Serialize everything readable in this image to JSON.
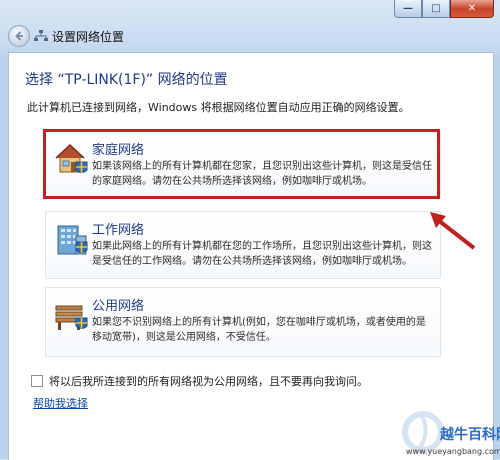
{
  "window": {
    "title": "设置网络位置",
    "controls": {
      "minimize": "—",
      "maximize": "□",
      "close": "✕"
    }
  },
  "main": {
    "heading": "选择 “TP-LINK(1F)” 网络的位置",
    "description": "此计算机已连接到网络，Windows 将根据网络位置自动应用正确的网络设置。",
    "options": [
      {
        "icon": "home-network-icon",
        "title": "家庭网络",
        "description": "如果该网络上的所有计算机都在您家，且您识别出这些计算机，则这是受信任的家庭网络。请勿在公共场所选择该网络，例如咖啡厅或机场。",
        "highlighted": true
      },
      {
        "icon": "work-network-icon",
        "title": "工作网络",
        "description": "如果此网络上的所有计算机都在您的工作场所，且您识别出这些计算机，则这是受信任的工作网络。请勿在公共场所选择该网络，例如咖啡厅或机场。",
        "highlighted": false
      },
      {
        "icon": "public-network-icon",
        "title": "公用网络",
        "description": "如果您不识别网络上的所有计算机(例如，您在咖啡厅或机场，或者使用的是移动宽带)，则这是公用网络，不受信任。",
        "highlighted": false
      }
    ],
    "treat_all_public_checkbox": {
      "label": "将以后我所连接到的所有网络视为公用网络，且不要再向我询问。",
      "checked": false
    },
    "help_link": "帮助我选择"
  },
  "watermark": {
    "text": "越牛百科网",
    "url": "www.yueyangbang.com"
  },
  "colors": {
    "highlight": "#c0221f",
    "heading": "#1e3a8a",
    "link": "#0645ad",
    "watermark": "#2b6cc4"
  }
}
